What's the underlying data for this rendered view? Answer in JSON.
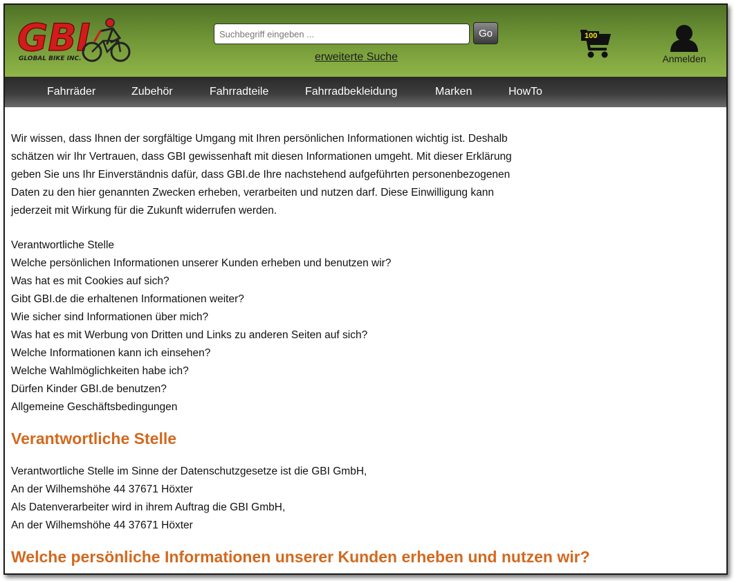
{
  "header": {
    "logo": {
      "text": "GBI",
      "tagline": "GLOBAL BIKE INC."
    },
    "search": {
      "placeholder": "Suchbegriff eingeben ...",
      "value": "",
      "button_label": "Go"
    },
    "advanced_search_label": "erweiterte Suche",
    "cart": {
      "count": "100"
    },
    "login_label": "Anmelden",
    "colors": {
      "header_green": "#6e9436",
      "logo_red": "#d01c1c"
    }
  },
  "nav": {
    "items": [
      {
        "label": "Fahrräder"
      },
      {
        "label": "Zubehör"
      },
      {
        "label": "Fahrradteile"
      },
      {
        "label": "Fahrradbekleidung"
      },
      {
        "label": "Marken"
      },
      {
        "label": "HowTo"
      }
    ]
  },
  "main": {
    "intro": "Wir wissen, dass Ihnen der sorgfältige Umgang mit Ihren persönlichen Informationen wichtig ist. Deshalb schätzen wir Ihr Vertrauen, dass GBI gewissenhaft mit diesen Informationen umgeht. Mit dieser Erklärung geben Sie uns Ihr Einverständnis dafür, dass GBI.de Ihre nachstehend aufgeführten personenbezogenen Daten zu den hier genannten Zwecken erheben, verarbeiten und nutzen darf. Diese Einwilligung kann jederzeit mit Wirkung für die Zukunft widerrufen werden.",
    "toc": [
      "Verantwortliche Stelle",
      "Welche persönlichen Informationen unserer Kunden erheben und benutzen wir?",
      "Was hat es mit Cookies auf sich?",
      "Gibt GBI.de die erhaltenen Informationen weiter?",
      "Wie sicher sind Informationen über mich?",
      "Was hat es mit Werbung von Dritten und Links zu anderen Seiten auf sich?",
      "Welche Informationen kann ich einsehen?",
      "Welche Wahlmöglichkeiten habe ich?",
      "Dürfen Kinder GBI.de benutzen?",
      "Allgemeine Geschäftsbedingungen"
    ],
    "section_responsible": {
      "heading": "Verantwortliche Stelle",
      "lines": [
        "Verantwortliche Stelle im Sinne der Datenschutzgesetze ist die GBI GmbH,",
        "An der Wilhemshöhe 44 37671 Höxter",
        "Als Datenverarbeiter wird in ihrem Auftrag die GBI GmbH,",
        "An der Wilhemshöhe 44 37671 Höxter"
      ]
    },
    "section_information": {
      "heading": "Welche persönliche Informationen unserer Kunden erheben und nutzen wir?"
    },
    "colors": {
      "heading_orange": "#d2691e"
    }
  }
}
